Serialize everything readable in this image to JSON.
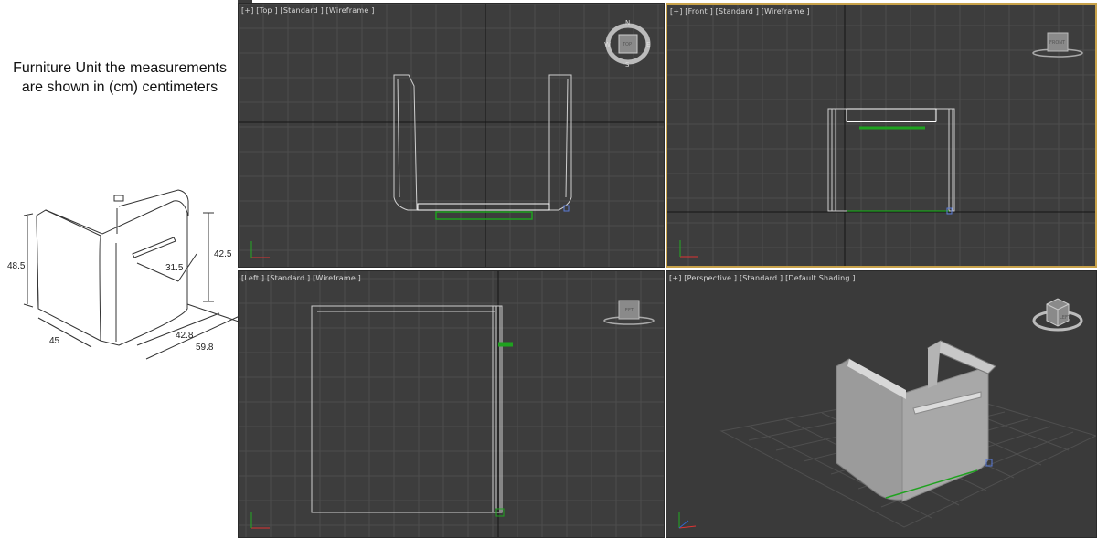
{
  "reference": {
    "caption_line1": "Furniture Unit the measurements",
    "caption_line2": "are shown in (cm) centimeters",
    "dimensions": {
      "height_front": "48.5",
      "height_side": "42.5",
      "inner_width": "31.5",
      "width": "45",
      "depth_inner": "42.8",
      "depth_total": "59.8"
    }
  },
  "viewports": {
    "top": {
      "label": "[+] [Top ] [Standard ] [Wireframe ]",
      "cube_face": "TOP",
      "compass": [
        "N",
        "E",
        "S",
        "W"
      ]
    },
    "front": {
      "label": "[+] [Front ] [Standard ] [Wireframe ]",
      "cube_face": "FRONT"
    },
    "left": {
      "label": "[Left ] [Standard ] [Wireframe ]",
      "cube_face": "LEFT"
    },
    "perspective": {
      "label": "[+] [Perspective ] [Standard ] [Default Shading ]",
      "cube_face": "LEFT"
    }
  },
  "colors": {
    "viewport_bg": "#3d3d3d",
    "grid_line": "#4d4d4d",
    "axis_line": "#111111",
    "wire": "#c8c8c8",
    "active_border": "#c8a24a",
    "handle_green": "#1fa21f"
  }
}
